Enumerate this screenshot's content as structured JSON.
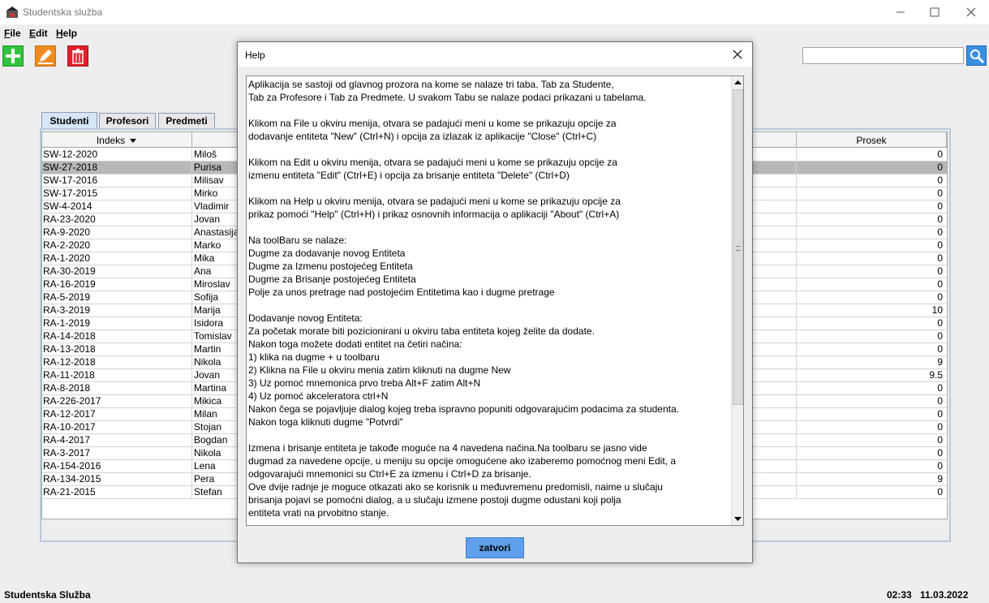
{
  "window": {
    "title": "Studentska služba",
    "icon": "app-icon"
  },
  "menu": {
    "file": {
      "mnemonic": "F",
      "rest": "ile"
    },
    "edit": {
      "mnemonic": "E",
      "rest": "dit"
    },
    "help": {
      "mnemonic": "H",
      "rest": "elp"
    }
  },
  "toolbar": {
    "add_icon": "plus-icon",
    "edit_icon": "pencil-icon",
    "delete_icon": "trash-icon",
    "search_value": "",
    "search_icon": "magnifier-icon"
  },
  "tabs": [
    "Studenti",
    "Profesori",
    "Predmeti"
  ],
  "table": {
    "headers": {
      "indeks": "Indeks",
      "prosek": "Prosek"
    },
    "rows": [
      {
        "indeks": "SW-12-2020",
        "ime": "Miloš",
        "prosek": "0"
      },
      {
        "indeks": "SW-27-2018",
        "ime": "Purisa",
        "prosek": "0"
      },
      {
        "indeks": "SW-17-2016",
        "ime": "Milisav",
        "prosek": "0"
      },
      {
        "indeks": "SW-17-2015",
        "ime": "Mirko",
        "prosek": "0"
      },
      {
        "indeks": "SW-4-2014",
        "ime": "Vladimir",
        "prosek": "0"
      },
      {
        "indeks": "RA-23-2020",
        "ime": "Jovan",
        "prosek": "0"
      },
      {
        "indeks": "RA-9-2020",
        "ime": "Anastasija",
        "prosek": "0"
      },
      {
        "indeks": "RA-2-2020",
        "ime": "Marko",
        "prosek": "0"
      },
      {
        "indeks": "RA-1-2020",
        "ime": "Mika",
        "prosek": "0"
      },
      {
        "indeks": "RA-30-2019",
        "ime": "Ana",
        "prosek": "0"
      },
      {
        "indeks": "RA-16-2019",
        "ime": "Miroslav",
        "prosek": "0"
      },
      {
        "indeks": "RA-5-2019",
        "ime": "Sofija",
        "prosek": "0"
      },
      {
        "indeks": "RA-3-2019",
        "ime": "Marija",
        "prosek": "10"
      },
      {
        "indeks": "RA-1-2019",
        "ime": "Isidora",
        "prosek": "0"
      },
      {
        "indeks": "RA-14-2018",
        "ime": "Tomislav",
        "prosek": "0"
      },
      {
        "indeks": "RA-13-2018",
        "ime": "Martin",
        "prosek": "0"
      },
      {
        "indeks": "RA-12-2018",
        "ime": "Nikola",
        "prosek": "9"
      },
      {
        "indeks": "RA-11-2018",
        "ime": "Jovan",
        "prosek": "9.5"
      },
      {
        "indeks": "RA-8-2018",
        "ime": "Martina",
        "prosek": "0"
      },
      {
        "indeks": "RA-226-2017",
        "ime": "Mikica",
        "prosek": "0"
      },
      {
        "indeks": "RA-12-2017",
        "ime": "Milan",
        "prosek": "0"
      },
      {
        "indeks": "RA-10-2017",
        "ime": "Stojan",
        "prosek": "0"
      },
      {
        "indeks": "RA-4-2017",
        "ime": "Bogdan",
        "prosek": "0"
      },
      {
        "indeks": "RA-3-2017",
        "ime": "Nikola",
        "prosek": "0"
      },
      {
        "indeks": "RA-154-2016",
        "ime": "Lena",
        "prosek": "0"
      },
      {
        "indeks": "RA-134-2015",
        "ime": "Pera",
        "prosek": "9"
      },
      {
        "indeks": "RA-21-2015",
        "ime": "Stefan",
        "prosek": "0"
      }
    ],
    "selected_index": 1
  },
  "status": {
    "app_name": "Studentska Služba",
    "time": "02:33",
    "date": "11.03.2022"
  },
  "dialog": {
    "title": "Help",
    "close_icon": "close-icon",
    "text": "Aplikacija se sastoji od glavnog prozora na kome se nalaze tri taba. Tab za Studente,\nTab za Profesore i Tab za Predmete. U svakom Tabu se nalaze podaci prikazani u tabelama.\n\nKlikom na File u okviru menija, otvara se padajući meni u kome se prikazuju opcije za\ndodavanje entiteta \"New\" (Ctrl+N) i opcija za izlazak iz aplikacije \"Close\" (Ctrl+C)\n\nKlikom na Edit u okviru menija, otvara se padajući meni u kome se prikazuju opcije za\nizmenu entiteta \"Edit\" (Ctrl+E) i opcija za brisanje entiteta \"Delete\" (Ctrl+D)\n\nKlikom na Help u okviru menija, otvara se padajući meni u kome se prikazuju opcije za\nprikaz pomoći \"Help\" (Ctrl+H) i prikaz osnovnih informacija o aplikaciji \"About\" (Ctrl+A)\n\nNa toolBaru se nalaze:\nDugme za dodavanje novog Entiteta\nDugme za Izmenu postojećeg Entiteta\nDugme za Brisanje postojećeg Entiteta\nPolje za unos pretrage nad postojećim Entitetima kao i dugme pretrage\n\nDodavanje novog Entiteta:\nZa početak morate biti pozicionirani u okviru taba entiteta kojeg želite da dodate.\nNakon toga možete dodati entitet na četiri načina:\n1) klika na dugme + u toolbaru\n2) Klikna na File u okviru menia zatim kliknuti na dugme New\n3) Uz pomoć mnemonica prvo treba Alt+F zatim Alt+N\n4) Uz pomoć akceleratora ctrl+N\nNakon čega se pojavljuje dialog kojeg treba ispravno popuniti odgovarajućim podacima za studenta.\nNakon toga kliknuti dugme \"Potvrdi\"\n\nIzmena i brisanje entiteta je takođe moguće na 4 navedena načina.Na toolbaru se jasno vide\ndugmad za navedene opcije, u meniju su opcije omogućene ako izaberemo pomoćnog meni Edit, a\nodgovarajući mnemonici su Ctrl+E za izmenu i Ctrl+D za brisanje.\nOve dvije radnje je moguce otkazati ako se korisnik u međuvremenu predomisli, naime u slučaju\nbrisanja pojavi se pomoćni dialog, a u slučaju izmene postoji dugme odustani koji polja\nentiteta vrati na prvobitno stanje.",
    "close_button": "zatvori"
  }
}
